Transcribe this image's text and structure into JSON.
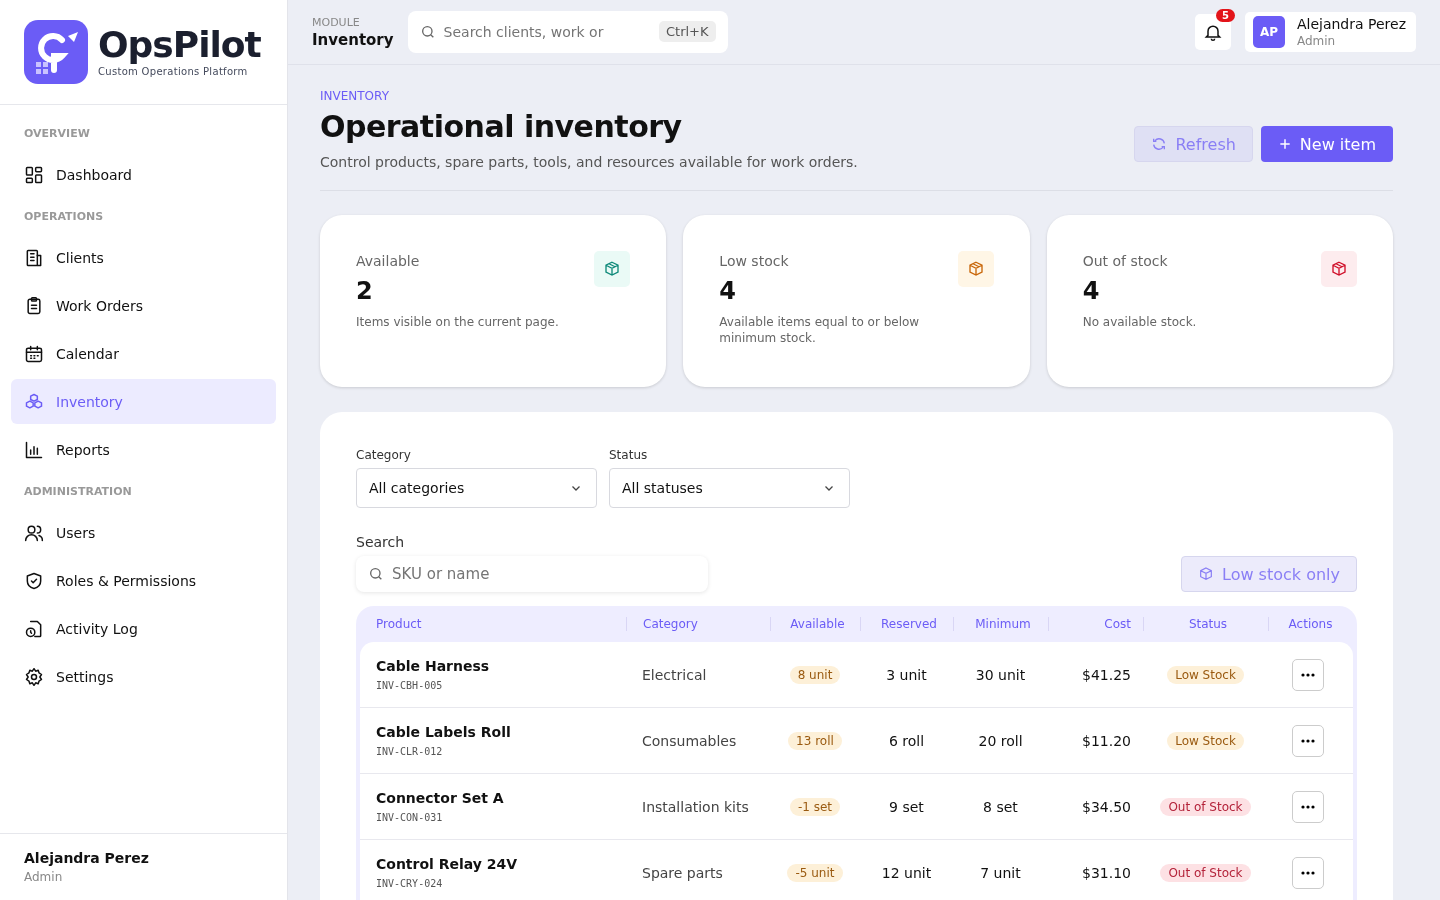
{
  "brand": {
    "name": "OpsPilot",
    "tagline": "Custom Operations Platform"
  },
  "sidebar": {
    "sections": [
      {
        "title": "OVERVIEW",
        "items": [
          {
            "label": "Dashboard",
            "selected": false
          }
        ]
      },
      {
        "title": "OPERATIONS",
        "items": [
          {
            "label": "Clients",
            "selected": false
          },
          {
            "label": "Work Orders",
            "selected": false
          },
          {
            "label": "Calendar",
            "selected": false
          },
          {
            "label": "Inventory",
            "selected": true
          },
          {
            "label": "Reports",
            "selected": false
          }
        ]
      },
      {
        "title": "ADMINISTRATION",
        "items": [
          {
            "label": "Users",
            "selected": false
          },
          {
            "label": "Roles & Permissions",
            "selected": false
          },
          {
            "label": "Activity Log",
            "selected": false
          },
          {
            "label": "Settings",
            "selected": false
          }
        ]
      }
    ],
    "user": {
      "name": "Alejandra Perez",
      "role": "Admin"
    }
  },
  "topbar": {
    "module_label": "MODULE",
    "module": "Inventory",
    "search_placeholder": "Search clients, work or",
    "shortcut": "Ctrl+K",
    "notifications": "5",
    "user": {
      "initials": "AP",
      "name": "Alejandra Perez",
      "role": "Admin"
    }
  },
  "header": {
    "eyebrow": "INVENTORY",
    "title": "Operational inventory",
    "subtitle": "Control products, spare parts, tools, and resources available for work orders.",
    "buttons": [
      "Refresh",
      "New item"
    ]
  },
  "stats": [
    {
      "kind": "available",
      "label": "Available",
      "value": "2",
      "note": "Items visible on the current page."
    },
    {
      "kind": "low",
      "label": "Low stock",
      "value": "4",
      "note": "Available items equal to or below minimum stock."
    },
    {
      "kind": "out",
      "label": "Out of stock",
      "value": "4",
      "note": "No available stock."
    }
  ],
  "filters": {
    "category": {
      "label": "Category",
      "value": "All categories"
    },
    "status": {
      "label": "Status",
      "value": "All statuses"
    },
    "search": {
      "label": "Search",
      "placeholder": "SKU or name"
    },
    "low_stock_button": "Low stock only"
  },
  "table": {
    "columns": [
      "Product",
      "Category",
      "Available",
      "Reserved",
      "Minimum",
      "Cost",
      "Status",
      "Actions"
    ],
    "rows": [
      {
        "name": "Cable Harness",
        "sku": "INV-CBH-005",
        "category": "Electrical",
        "available": "8 unit",
        "reserved": "3 unit",
        "minimum": "30 unit",
        "cost": "$41.25",
        "status": "Low Stock",
        "kind": "low"
      },
      {
        "name": "Cable Labels Roll",
        "sku": "INV-CLR-012",
        "category": "Consumables",
        "available": "13 roll",
        "reserved": "6 roll",
        "minimum": "20 roll",
        "cost": "$11.20",
        "status": "Low Stock",
        "kind": "low"
      },
      {
        "name": "Connector Set A",
        "sku": "INV-CON-031",
        "category": "Installation kits",
        "available": "-1 set",
        "reserved": "9 set",
        "minimum": "8 set",
        "cost": "$34.50",
        "status": "Out of Stock",
        "kind": "out"
      },
      {
        "name": "Control Relay 24V",
        "sku": "INV-CRY-024",
        "category": "Spare parts",
        "available": "-5 unit",
        "reserved": "12 unit",
        "minimum": "7 unit",
        "cost": "$31.10",
        "status": "Out of Stock",
        "kind": "out"
      }
    ]
  }
}
